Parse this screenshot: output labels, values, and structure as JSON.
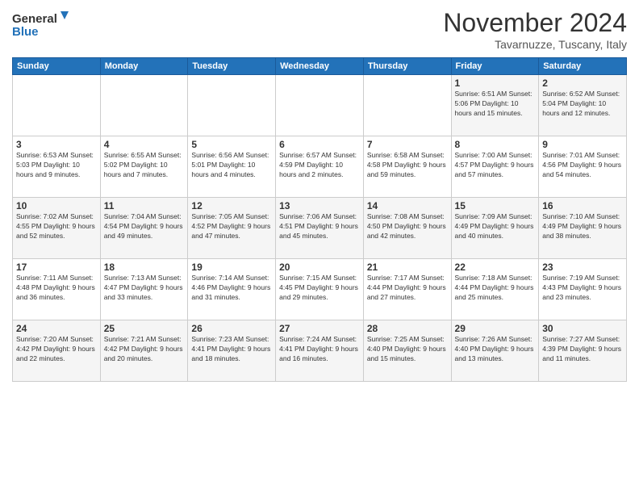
{
  "logo": {
    "line1": "General",
    "line2": "Blue"
  },
  "title": "November 2024",
  "subtitle": "Tavarnuzze, Tuscany, Italy",
  "days_of_week": [
    "Sunday",
    "Monday",
    "Tuesday",
    "Wednesday",
    "Thursday",
    "Friday",
    "Saturday"
  ],
  "weeks": [
    [
      {
        "day": "",
        "info": ""
      },
      {
        "day": "",
        "info": ""
      },
      {
        "day": "",
        "info": ""
      },
      {
        "day": "",
        "info": ""
      },
      {
        "day": "",
        "info": ""
      },
      {
        "day": "1",
        "info": "Sunrise: 6:51 AM\nSunset: 5:06 PM\nDaylight: 10 hours and 15 minutes."
      },
      {
        "day": "2",
        "info": "Sunrise: 6:52 AM\nSunset: 5:04 PM\nDaylight: 10 hours and 12 minutes."
      }
    ],
    [
      {
        "day": "3",
        "info": "Sunrise: 6:53 AM\nSunset: 5:03 PM\nDaylight: 10 hours and 9 minutes."
      },
      {
        "day": "4",
        "info": "Sunrise: 6:55 AM\nSunset: 5:02 PM\nDaylight: 10 hours and 7 minutes."
      },
      {
        "day": "5",
        "info": "Sunrise: 6:56 AM\nSunset: 5:01 PM\nDaylight: 10 hours and 4 minutes."
      },
      {
        "day": "6",
        "info": "Sunrise: 6:57 AM\nSunset: 4:59 PM\nDaylight: 10 hours and 2 minutes."
      },
      {
        "day": "7",
        "info": "Sunrise: 6:58 AM\nSunset: 4:58 PM\nDaylight: 9 hours and 59 minutes."
      },
      {
        "day": "8",
        "info": "Sunrise: 7:00 AM\nSunset: 4:57 PM\nDaylight: 9 hours and 57 minutes."
      },
      {
        "day": "9",
        "info": "Sunrise: 7:01 AM\nSunset: 4:56 PM\nDaylight: 9 hours and 54 minutes."
      }
    ],
    [
      {
        "day": "10",
        "info": "Sunrise: 7:02 AM\nSunset: 4:55 PM\nDaylight: 9 hours and 52 minutes."
      },
      {
        "day": "11",
        "info": "Sunrise: 7:04 AM\nSunset: 4:54 PM\nDaylight: 9 hours and 49 minutes."
      },
      {
        "day": "12",
        "info": "Sunrise: 7:05 AM\nSunset: 4:52 PM\nDaylight: 9 hours and 47 minutes."
      },
      {
        "day": "13",
        "info": "Sunrise: 7:06 AM\nSunset: 4:51 PM\nDaylight: 9 hours and 45 minutes."
      },
      {
        "day": "14",
        "info": "Sunrise: 7:08 AM\nSunset: 4:50 PM\nDaylight: 9 hours and 42 minutes."
      },
      {
        "day": "15",
        "info": "Sunrise: 7:09 AM\nSunset: 4:49 PM\nDaylight: 9 hours and 40 minutes."
      },
      {
        "day": "16",
        "info": "Sunrise: 7:10 AM\nSunset: 4:49 PM\nDaylight: 9 hours and 38 minutes."
      }
    ],
    [
      {
        "day": "17",
        "info": "Sunrise: 7:11 AM\nSunset: 4:48 PM\nDaylight: 9 hours and 36 minutes."
      },
      {
        "day": "18",
        "info": "Sunrise: 7:13 AM\nSunset: 4:47 PM\nDaylight: 9 hours and 33 minutes."
      },
      {
        "day": "19",
        "info": "Sunrise: 7:14 AM\nSunset: 4:46 PM\nDaylight: 9 hours and 31 minutes."
      },
      {
        "day": "20",
        "info": "Sunrise: 7:15 AM\nSunset: 4:45 PM\nDaylight: 9 hours and 29 minutes."
      },
      {
        "day": "21",
        "info": "Sunrise: 7:17 AM\nSunset: 4:44 PM\nDaylight: 9 hours and 27 minutes."
      },
      {
        "day": "22",
        "info": "Sunrise: 7:18 AM\nSunset: 4:44 PM\nDaylight: 9 hours and 25 minutes."
      },
      {
        "day": "23",
        "info": "Sunrise: 7:19 AM\nSunset: 4:43 PM\nDaylight: 9 hours and 23 minutes."
      }
    ],
    [
      {
        "day": "24",
        "info": "Sunrise: 7:20 AM\nSunset: 4:42 PM\nDaylight: 9 hours and 22 minutes."
      },
      {
        "day": "25",
        "info": "Sunrise: 7:21 AM\nSunset: 4:42 PM\nDaylight: 9 hours and 20 minutes."
      },
      {
        "day": "26",
        "info": "Sunrise: 7:23 AM\nSunset: 4:41 PM\nDaylight: 9 hours and 18 minutes."
      },
      {
        "day": "27",
        "info": "Sunrise: 7:24 AM\nSunset: 4:41 PM\nDaylight: 9 hours and 16 minutes."
      },
      {
        "day": "28",
        "info": "Sunrise: 7:25 AM\nSunset: 4:40 PM\nDaylight: 9 hours and 15 minutes."
      },
      {
        "day": "29",
        "info": "Sunrise: 7:26 AM\nSunset: 4:40 PM\nDaylight: 9 hours and 13 minutes."
      },
      {
        "day": "30",
        "info": "Sunrise: 7:27 AM\nSunset: 4:39 PM\nDaylight: 9 hours and 11 minutes."
      }
    ]
  ]
}
